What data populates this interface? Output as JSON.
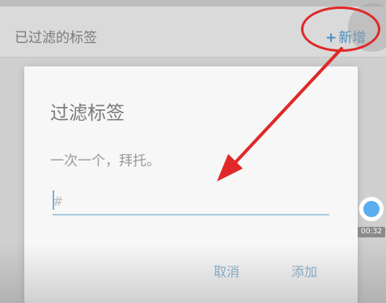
{
  "header": {
    "title": "已过滤的标签",
    "add_plus": "+",
    "add_label": "新增"
  },
  "dialog": {
    "title": "过滤标签",
    "message": "一次一个，拜托。",
    "input": {
      "value": "",
      "placeholder": "#"
    },
    "cancel_label": "取消",
    "add_label": "添加"
  },
  "recorder": {
    "time": "00:32"
  },
  "colors": {
    "accent": "#4a8fbf",
    "annotation": "#e02828",
    "record_dot": "#5aaef0"
  },
  "icons": [
    "record-dot-icon",
    "red-arrow-annotation",
    "red-circle-annotation"
  ]
}
